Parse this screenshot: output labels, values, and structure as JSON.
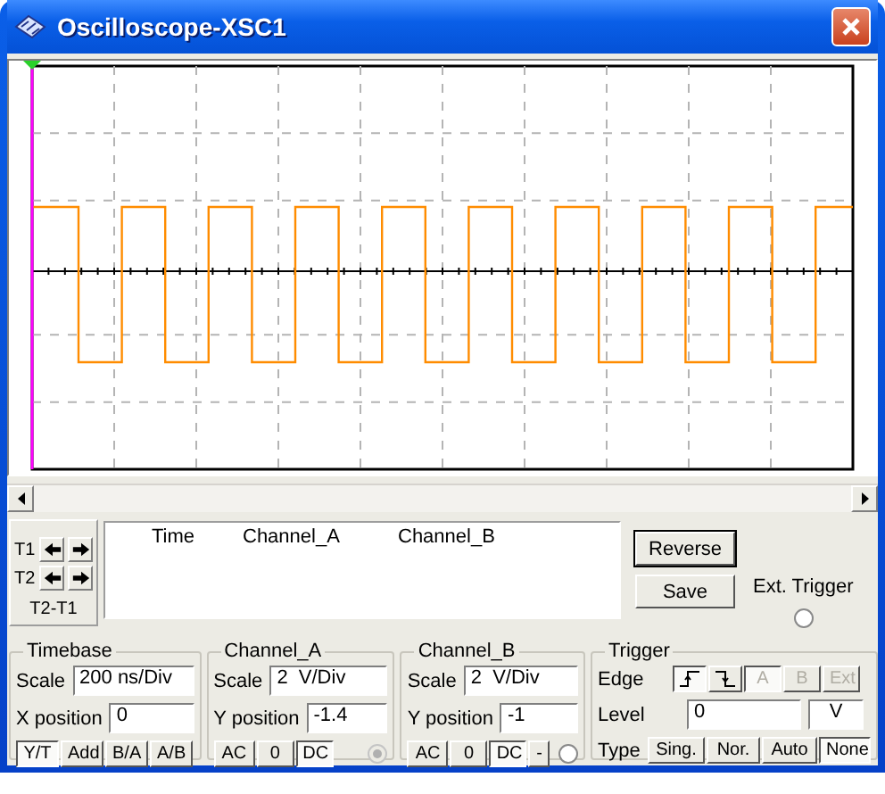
{
  "window": {
    "title": "Oscilloscope-XSC1"
  },
  "cursor_panel": {
    "t1_label": "T1",
    "t2_label": "T2",
    "diff_label": "T2-T1"
  },
  "readout": {
    "columns": [
      "Time",
      "Channel_A",
      "Channel_B"
    ]
  },
  "buttons": [
    {
      "label": "Reverse",
      "kind": "default"
    },
    {
      "label": "Save",
      "kind": "normal"
    }
  ],
  "ext_trigger": {
    "label": "Ext. Trigger",
    "checked": false
  },
  "timebase": {
    "title": "Timebase",
    "scale_label": "Scale",
    "scale": "200 ns/Div",
    "xpos_label": "X position",
    "xpos": "0",
    "modes": [
      {
        "label": "Y/T",
        "selected": true
      },
      {
        "label": "Add",
        "selected": false
      },
      {
        "label": "B/A",
        "selected": false
      },
      {
        "label": "A/B",
        "selected": false
      }
    ]
  },
  "channel_a": {
    "title": "Channel_A",
    "scale_label": "Scale",
    "scale": "2  V/Div",
    "ypos_label": "Y position",
    "ypos": "-1.4",
    "couplings": [
      {
        "label": "AC",
        "selected": false
      },
      {
        "label": "0",
        "selected": false
      },
      {
        "label": "DC",
        "selected": true
      }
    ],
    "radio": {
      "checked": true,
      "disabled": true
    }
  },
  "channel_b": {
    "title": "Channel_B",
    "scale_label": "Scale",
    "scale": "2  V/Div",
    "ypos_label": "Y position",
    "ypos": "-1",
    "couplings": [
      {
        "label": "AC",
        "selected": false
      },
      {
        "label": "0",
        "selected": false
      },
      {
        "label": "DC",
        "selected": true
      },
      {
        "label": "-",
        "selected": false
      }
    ],
    "radio": {
      "checked": false,
      "disabled": false
    }
  },
  "trigger": {
    "title": "Trigger",
    "edge_label": "Edge",
    "edges": [
      {
        "kind": "rising",
        "selected": true
      },
      {
        "kind": "falling",
        "selected": false
      }
    ],
    "sources": [
      {
        "label": "A",
        "selected": true,
        "disabled": true
      },
      {
        "label": "B",
        "selected": false,
        "disabled": true
      },
      {
        "label": "Ext",
        "selected": false,
        "disabled": true
      }
    ],
    "level_label": "Level",
    "level": "0",
    "level_unit": "V",
    "type_label": "Type",
    "types": [
      {
        "label": "Sing.",
        "selected": false
      },
      {
        "label": "Nor.",
        "selected": false
      },
      {
        "label": "Auto",
        "selected": false
      },
      {
        "label": "None",
        "selected": true
      }
    ]
  }
}
